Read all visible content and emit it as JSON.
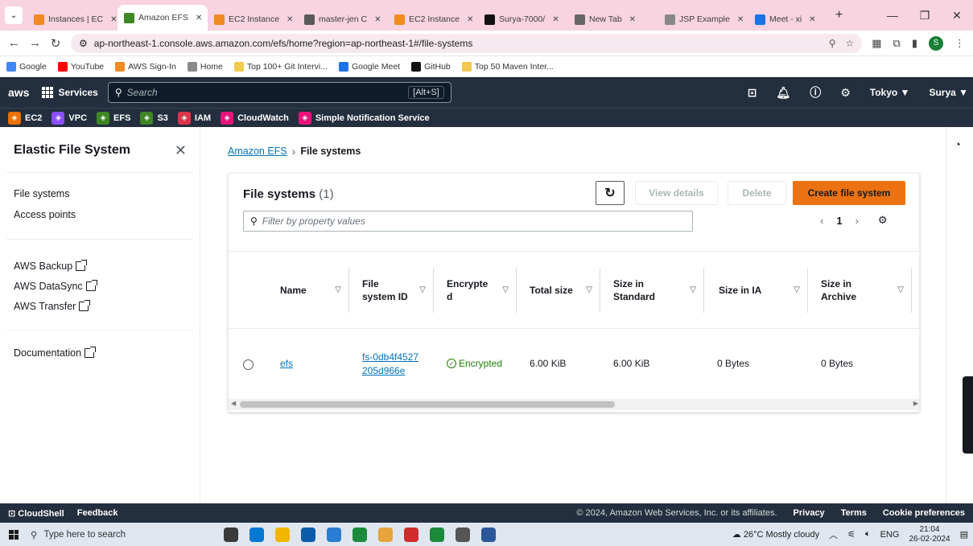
{
  "browser": {
    "tabs": [
      {
        "label": "Instances | EC",
        "color": "#f08a24"
      },
      {
        "label": "Amazon EFS",
        "color": "#3f8624",
        "active": true
      },
      {
        "label": "EC2 Instance",
        "color": "#f08a24"
      },
      {
        "label": "master-jen C",
        "color": "#5a5a5a"
      },
      {
        "label": "EC2 Instance",
        "color": "#f08a24"
      },
      {
        "label": "Surya-7000/",
        "color": "#111111"
      },
      {
        "label": "New Tab",
        "color": "#666666"
      },
      {
        "label": "JSP Example",
        "color": "#888888"
      },
      {
        "label": "Meet - xi",
        "color": "#1a73e8"
      }
    ],
    "url": "ap-northeast-1.console.aws.amazon.com/efs/home?region=ap-northeast-1#/file-systems",
    "profile_initial": "S",
    "bookmarks": [
      {
        "label": "Google",
        "color": "#4285f4"
      },
      {
        "label": "YouTube",
        "color": "#ff0000"
      },
      {
        "label": "AWS Sign-In",
        "color": "#f08a24"
      },
      {
        "label": "Home",
        "color": "#8a8a8a"
      },
      {
        "label": "Top 100+ Git Intervi...",
        "color": "#f2c94c"
      },
      {
        "label": "Google Meet",
        "color": "#1a73e8"
      },
      {
        "label": "GitHub",
        "color": "#111111"
      },
      {
        "label": "Top 50 Maven Inter...",
        "color": "#f2c94c"
      }
    ]
  },
  "aws_nav": {
    "logo": "aws",
    "services_label": "Services",
    "search_placeholder": "Search",
    "search_shortcut": "[Alt+S]",
    "region": "Tokyo ▼",
    "user": "Surya ▼"
  },
  "favorites": [
    {
      "label": "EC2",
      "color": "#ed7100"
    },
    {
      "label": "VPC",
      "color": "#8c4fff"
    },
    {
      "label": "EFS",
      "color": "#3f8624"
    },
    {
      "label": "S3",
      "color": "#3f8624"
    },
    {
      "label": "IAM",
      "color": "#dd344c"
    },
    {
      "label": "CloudWatch",
      "color": "#e7157b"
    },
    {
      "label": "Simple Notification Service",
      "color": "#e7157b"
    }
  ],
  "side": {
    "title": "Elastic File System",
    "links": [
      "File systems",
      "Access points"
    ],
    "external_links": [
      "AWS Backup",
      "AWS DataSync",
      "AWS Transfer"
    ],
    "documentation": "Documentation"
  },
  "breadcrumb": {
    "parent": "Amazon EFS",
    "current": "File systems"
  },
  "container": {
    "title": "File systems",
    "count": "(1)",
    "view_details": "View details",
    "delete": "Delete",
    "create": "Create file system",
    "filter_placeholder": "Filter by property values",
    "page": "1"
  },
  "table": {
    "columns": [
      "Name",
      "File system ID",
      "Encrypted",
      "Total size",
      "Size in Standard",
      "Size in IA",
      "Size in Archive"
    ],
    "rows": [
      {
        "name": "efs",
        "id": "fs-0db4f4527205d966e",
        "encrypted": "Encrypted",
        "total": "6.00 KiB",
        "standard": "6.00 KiB",
        "ia": "0 Bytes",
        "archive": "0 Bytes"
      }
    ]
  },
  "footer": {
    "cloudshell": "CloudShell",
    "feedback": "Feedback",
    "copyright": "© 2024, Amazon Web Services, Inc. or its affiliates.",
    "privacy": "Privacy",
    "terms": "Terms",
    "cookies": "Cookie preferences"
  },
  "taskbar": {
    "search": "Type here to search",
    "weather": "26°C  Mostly cloudy",
    "lang": "ENG",
    "time": "21:04",
    "date": "26-02-2024",
    "apps": [
      "#3a3a3a",
      "#0078d4",
      "#f2b600",
      "#0a5cab",
      "#2b7cd3",
      "#1a8a3a",
      "#e8a33d",
      "#d12b2b",
      "#1a8a3a",
      "#555555",
      "#2b579a"
    ]
  }
}
